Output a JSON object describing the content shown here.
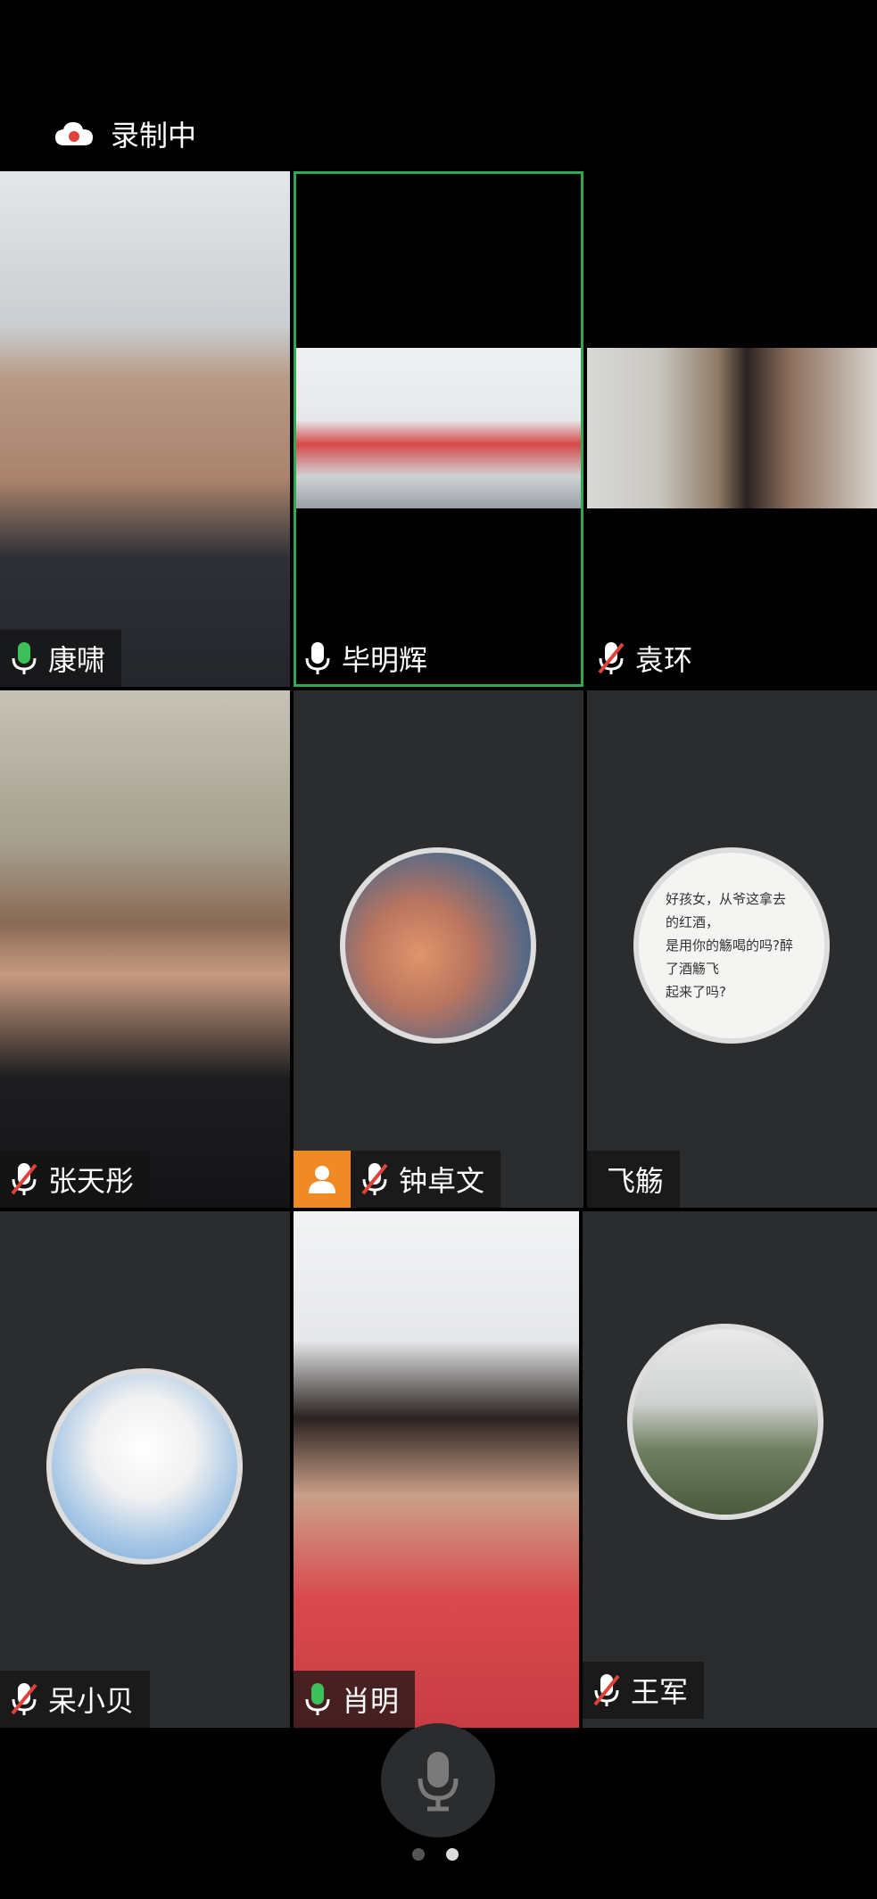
{
  "recording": {
    "icon": "cloud-record-icon",
    "label": "录制中"
  },
  "participants": [
    {
      "name": "康啸",
      "mic": "on-green"
    },
    {
      "name": "毕明辉",
      "mic": "on-white"
    },
    {
      "name": "袁环",
      "mic": "muted"
    },
    {
      "name": "张天彤",
      "mic": "muted"
    },
    {
      "name": "钟卓文",
      "mic": "muted"
    },
    {
      "name": "飞觞",
      "mic": "none"
    },
    {
      "name": "呆小贝",
      "mic": "muted"
    },
    {
      "name": "肖明",
      "mic": "on-green"
    },
    {
      "name": "王军",
      "mic": "muted"
    }
  ],
  "quote_avatar": {
    "lines": [
      "好孩女，从爷这拿去的红酒，",
      "是用你的觞喝的吗?醉了酒觞飞",
      "起来了吗?"
    ]
  },
  "colors": {
    "active_border": "#2fa853",
    "tile_bg": "#2b2c2e",
    "mic_on": "#3cc05a",
    "mute_slash": "#e0423b",
    "person_chip": "#f08a24"
  },
  "pager": {
    "pages": 2,
    "current": 2
  }
}
